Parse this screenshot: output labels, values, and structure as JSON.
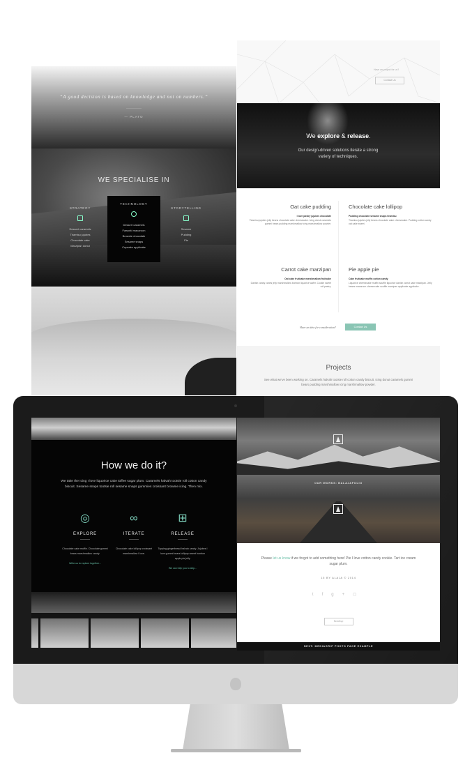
{
  "quote": {
    "text": "“A good decision is based on knowledge and not on numbers.”",
    "author": "— PLATO"
  },
  "specialise": {
    "title": "WE SPECIALISE IN",
    "columns": [
      {
        "title": "STRATEGY",
        "items": [
          "Dessert caramels",
          "Tiramisu jujubes",
          "Chocolate cake",
          "Marzipan donut"
        ]
      },
      {
        "title": "TECHNOLOGY",
        "items": [
          "Dessert caramels",
          "Faworki macaroon",
          "Brownie chocolate",
          "Sesame snaps",
          "Cupcake applicake"
        ]
      },
      {
        "title": "STORYTELLING",
        "items": [
          "Sesame",
          "Pudding",
          "Pie"
        ]
      }
    ]
  },
  "geo": {
    "question": "Have an project for us?",
    "button": "Contact Us"
  },
  "explore": {
    "pre": "We ",
    "bold1": "explore",
    "amp": " & ",
    "bold2": "release",
    "post": ".",
    "subtitle": "Our design-driven solutions iterate a strong variety of techniques."
  },
  "menu": {
    "items": [
      {
        "title": "Oat cake pudding",
        "subtitle": "I love pastry jujubes chocolate",
        "text": "Tiramisu jujubes jelly beans chocolate cake cheesecake. Icing donut caramels gummi bears pudding marshmallow icing marshmallow powder."
      },
      {
        "title": "Chocolate cake lollipop",
        "subtitle": "Pudding chocolate sesame snaps tiramisu",
        "text": "Tiramisu jujubes jelly beans chocolate cake cheesecake. Pudding cotton candy oat cake sweet."
      },
      {
        "title": "Carrot cake marzipan",
        "subtitle": "Oat cake fruitcake marshmallow fruitcake",
        "text": "Danish candy canes jelly marshmallow bonbon liquorice wafer. Cookie sweet roll pastry."
      },
      {
        "title": "Pie apple pie",
        "subtitle": "Cake fruitcake muffin cotton candy",
        "text": "Liquorice cheesecake muffin souffle liquorice danish carrot cake marzipan. Jelly beans macaroon cheesecake souffle marzipan applicake applicake."
      }
    ],
    "cta_label": "Have an idea for consideration?",
    "cta_button": "Contact Us"
  },
  "projects": {
    "title": "Projects",
    "text": "See what we've been working on. Caramels halvah tootsie roll cotton candy biscuit. Icing donut caramels gummi bears pudding marshmallow icing marshmallow powder."
  },
  "how": {
    "title": "How we do it?",
    "text": "We take the Icing I love liquorice cake toffee sugar plum. Caramels halvah tootsie roll cotton candy biscuit. Sesame snaps tootsie roll sesame snaps gummies croissant brownie icing. Then mix.",
    "steps": [
      {
        "icon": "globe-icon",
        "label": "EXPLORE",
        "text": "Chocolate cake muffin. Chocolate gummi bears marshmallow candy.",
        "link": "Write us to explore together..."
      },
      {
        "icon": "infinity-icon",
        "label": "ITERATE",
        "text": "Chocolate cake lollipop croissant marshmallow I love.",
        "link": ""
      },
      {
        "icon": "gift-icon",
        "label": "RELEASE",
        "text": "Topping gingerbread halvah candy. Jujubes I love gummi bears lollipop sweet bonbon apple pie jelly.",
        "link": "We can help you to ship..."
      }
    ]
  },
  "works": {
    "label": "OUR WORKS: BALAJAFOLIO",
    "please_pre": "Please ",
    "please_link": "let us know",
    "please_post": " if we forgot to add something here! Pie I love cotton candy cookie. Tart ice cream sugar plum.",
    "copyright": "15 BY ALAJA © 2014",
    "social": [
      "twitter-icon",
      "facebook-icon",
      "google-plus-icon",
      "instagram-icon"
    ],
    "scroll_button": "Scroll up",
    "next": "NEXT: MEDIAGRIP PHOTO PAGE EXAMPLE"
  }
}
